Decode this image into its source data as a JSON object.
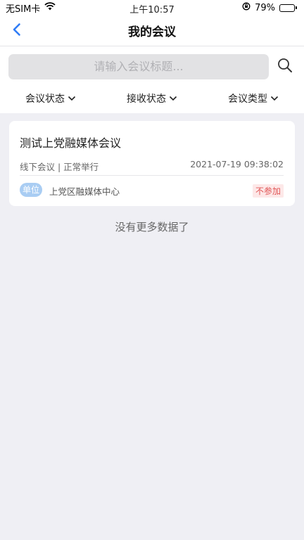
{
  "status_bar": {
    "carrier": "无SIM卡",
    "time": "上午10:57",
    "battery": "79%",
    "battery_level": 0.79
  },
  "nav": {
    "title": "我的会议",
    "back_icon": "chevron-left-icon"
  },
  "search": {
    "placeholder": "请输入会议标题...",
    "value": "",
    "icon": "search-icon"
  },
  "filters": [
    {
      "label": "会议状态"
    },
    {
      "label": "接收状态"
    },
    {
      "label": "会议类型"
    }
  ],
  "meetings": [
    {
      "title": "测试上党融媒体会议",
      "meta": "线下会议 | 正常举行",
      "time": "2021-07-19 09:38:02",
      "unit_badge": "单位",
      "unit_name": "上党区融媒体中心",
      "attend_status": "不参加"
    }
  ],
  "footer_text": "没有更多数据了",
  "colors": {
    "accent": "#2f7cf6",
    "background": "#efeff4",
    "badge": "#a9cdf3",
    "tag_text": "#e15555",
    "tag_bg": "#fde8e8"
  }
}
